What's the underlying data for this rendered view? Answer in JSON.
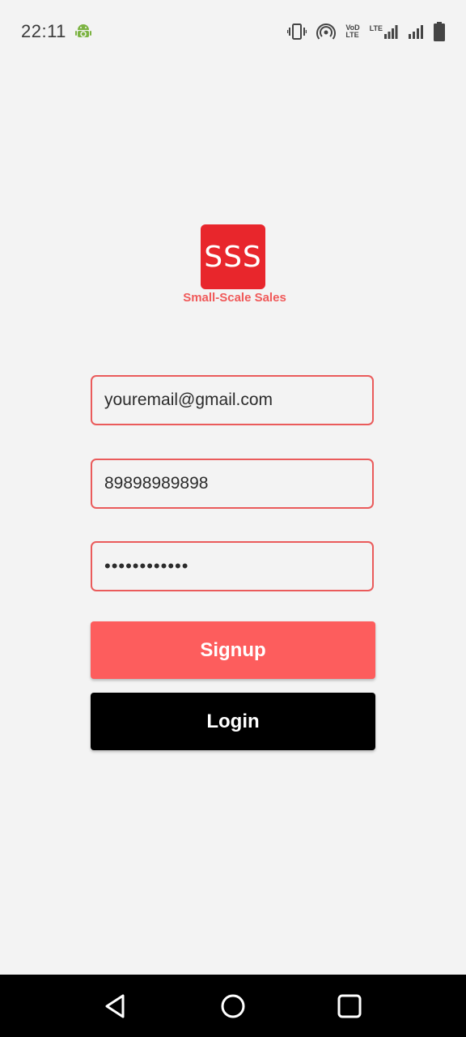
{
  "status_bar": {
    "time": "22:11",
    "icons": [
      "android-debug-icon",
      "vibrate-icon",
      "hotspot-icon",
      "volte-icon",
      "lte-signal-icon",
      "signal-icon",
      "battery-icon"
    ],
    "volte_top": "VoD",
    "volte_bottom": "LTE",
    "lte_label": "LTE"
  },
  "logo": {
    "text": "SSS",
    "caption": "Small-Scale Sales",
    "color": "#e8262c"
  },
  "form": {
    "email_value": "youremail@gmail.com",
    "phone_value": "89898989898",
    "password_value": "••••••••••••"
  },
  "buttons": {
    "signup_label": "Signup",
    "login_label": "Login",
    "signup_color": "#fd5d5d",
    "login_color": "#000000"
  },
  "nav_bar": {
    "icons": [
      "back-icon",
      "home-icon",
      "recents-icon"
    ]
  }
}
